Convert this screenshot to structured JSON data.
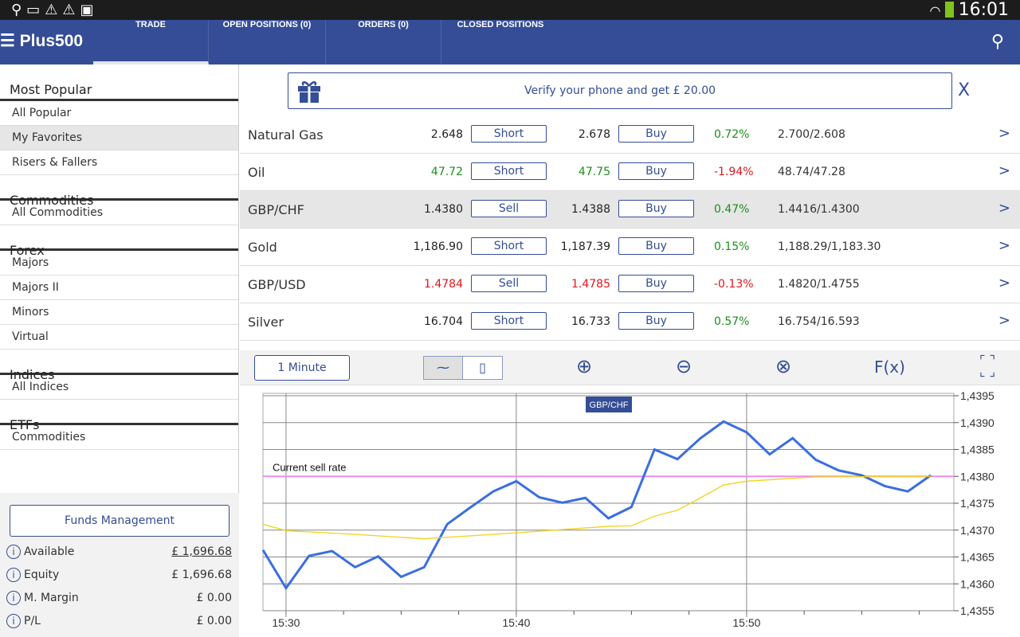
{
  "status_bar": {
    "left_icons": [
      "usb-icon",
      "screen-check-icon",
      "warning-icon",
      "warning-icon",
      "clipboard-check-icon"
    ],
    "time": "16:01"
  },
  "nav": {
    "logo": "Plus500",
    "tabs": [
      {
        "label": "TRADE",
        "active": true
      },
      {
        "label": "OPEN POSITIONS (0)"
      },
      {
        "label": "ORDERS (0)"
      },
      {
        "label": "CLOSED POSITIONS"
      }
    ]
  },
  "sidebar": {
    "sections": [
      {
        "title": "Most Popular",
        "items": [
          "All Popular",
          "My Favorites",
          "Risers & Fallers"
        ],
        "selected": 1
      },
      {
        "title": "Commodities",
        "items": [
          "All Commodities"
        ]
      },
      {
        "title": "Forex",
        "items": [
          "Majors",
          "Majors II",
          "Minors",
          "Virtual"
        ]
      },
      {
        "title": "Indices",
        "items": [
          "All Indices"
        ]
      },
      {
        "title": "ETFs",
        "items": [
          "Commodities"
        ]
      }
    ]
  },
  "funds": {
    "button": "Funds Management",
    "rows": [
      {
        "label": "Available",
        "value": "£ 1,696.68"
      },
      {
        "label": "Equity",
        "value": "£ 1,696.68"
      },
      {
        "label": "M. Margin",
        "value": "£ 0.00"
      },
      {
        "label": "P/L",
        "value": "£ 0.00"
      }
    ]
  },
  "banner": {
    "text": "Verify your phone and get £ 20.00",
    "close": "X"
  },
  "instruments": [
    {
      "name": "Natural Gas",
      "sell": "2.648",
      "sell_label": "Short",
      "buy": "2.678",
      "buy_label": "Buy",
      "change": "0.72%",
      "high_low": "2.700/2.608",
      "price_color": "",
      "change_color": "green"
    },
    {
      "name": "Oil",
      "sell": "47.72",
      "sell_label": "Short",
      "buy": "47.75",
      "buy_label": "Buy",
      "change": "-1.94%",
      "high_low": "48.74/47.28",
      "price_color": "green",
      "change_color": "red"
    },
    {
      "name": "GBP/CHF",
      "sell": "1.4380",
      "sell_label": "Sell",
      "buy": "1.4388",
      "buy_label": "Buy",
      "change": "0.47%",
      "high_low": "1.4416/1.4300",
      "price_color": "",
      "change_color": "green",
      "selected": true
    },
    {
      "name": "Gold",
      "sell": "1,186.90",
      "sell_label": "Short",
      "buy": "1,187.39",
      "buy_label": "Buy",
      "change": "0.15%",
      "high_low": "1,188.29/1,183.30",
      "price_color": "",
      "change_color": "green"
    },
    {
      "name": "GBP/USD",
      "sell": "1.4784",
      "sell_label": "Sell",
      "buy": "1.4785",
      "buy_label": "Buy",
      "change": "-0.13%",
      "high_low": "1.4820/1.4755",
      "price_color": "red",
      "change_color": "red"
    },
    {
      "name": "Silver",
      "sell": "16.704",
      "sell_label": "Short",
      "buy": "16.733",
      "buy_label": "Buy",
      "change": "0.57%",
      "high_low": "16.754/16.593",
      "price_color": "",
      "change_color": "green"
    }
  ],
  "chart_toolbar": {
    "interval": "1 Minute",
    "fx": "F(x)",
    "icons": [
      "line-chart-icon",
      "candlestick-icon",
      "zoom-in-icon",
      "zoom-out-icon",
      "zoom-reset-icon",
      "expand-icon"
    ]
  },
  "chart_data": {
    "type": "line",
    "title": "GBP/CHF",
    "annotation": "Current sell rate",
    "sell_rate": 1.438,
    "x_ticks": [
      "15:30",
      "15:40",
      "15:50"
    ],
    "y_ticks": [
      "1,4395",
      "1,4390",
      "1,4385",
      "1,4380",
      "1,4375",
      "1,4370",
      "1,4365",
      "1,4360",
      "1,4355"
    ],
    "ylim": [
      1.4355,
      1.4395
    ],
    "xlim": [
      "15:29",
      "15:59"
    ],
    "grid": true,
    "colors": {
      "price": "#3a6ee0",
      "average": "#f2d21b",
      "sell_rate": "#f08cf0"
    },
    "series": [
      {
        "x": [
          "15:29",
          "15:30",
          "15:31",
          "15:32",
          "15:33",
          "15:34",
          "15:35",
          "15:36",
          "15:37",
          "15:38",
          "15:39",
          "15:40",
          "15:41",
          "15:42",
          "15:43",
          "15:44",
          "15:45",
          "15:46",
          "15:47",
          "15:48",
          "15:49",
          "15:50",
          "15:51",
          "15:52",
          "15:53",
          "15:54",
          "15:55",
          "15:56",
          "15:57",
          "15:58"
        ],
        "values": [
          1.43663,
          1.43592,
          1.43652,
          1.43661,
          1.43631,
          1.43651,
          1.43613,
          1.43631,
          1.43711,
          1.43742,
          1.43772,
          1.43791,
          1.43761,
          1.43751,
          1.4376,
          1.43722,
          1.43743,
          1.4385,
          1.43832,
          1.43871,
          1.43902,
          1.43882,
          1.43841,
          1.43871,
          1.43831,
          1.43811,
          1.43802,
          1.43782,
          1.43772,
          1.43802
        ]
      },
      {
        "x": [
          "15:29",
          "15:30",
          "15:33",
          "15:36",
          "15:39",
          "15:42",
          "15:44",
          "15:45",
          "15:46",
          "15:47",
          "15:48",
          "15:49",
          "15:50",
          "15:53",
          "15:58"
        ],
        "values": [
          1.43711,
          1.43699,
          1.43692,
          1.43684,
          1.43692,
          1.43701,
          1.43707,
          1.43708,
          1.43726,
          1.43737,
          1.4376,
          1.43784,
          1.43791,
          1.43799,
          1.438
        ]
      }
    ]
  }
}
